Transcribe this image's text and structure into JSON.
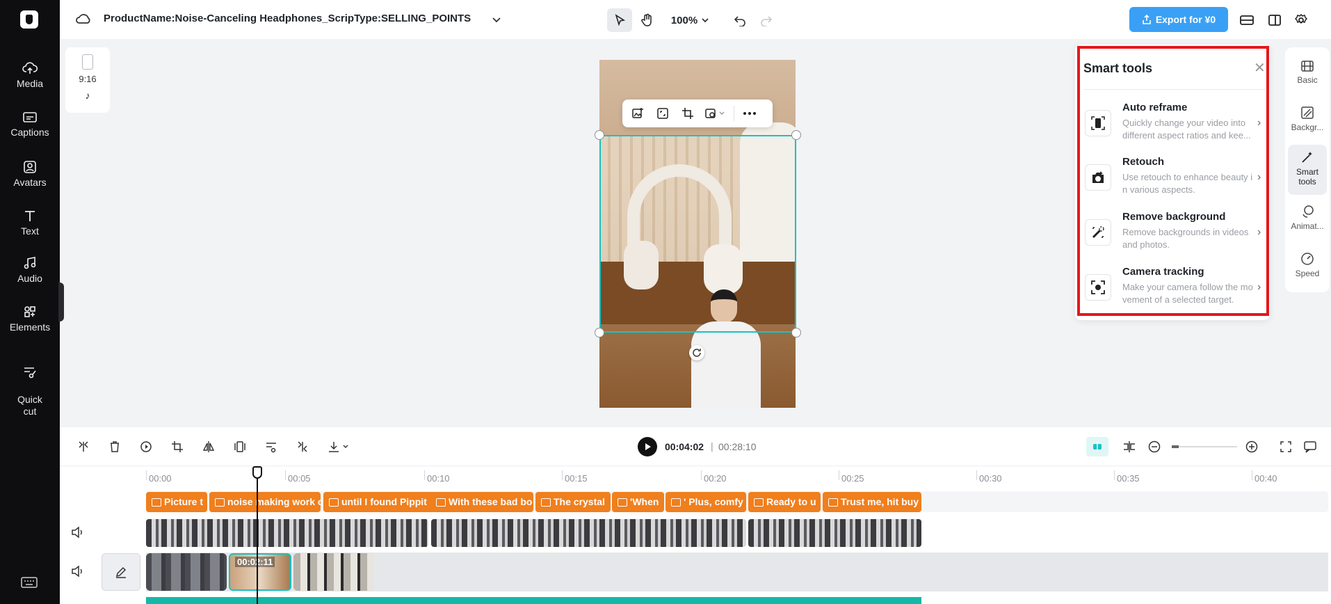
{
  "nav": {
    "items": [
      {
        "label": "Media",
        "icon": "cloud-upload-icon"
      },
      {
        "label": "Captions",
        "icon": "captions-icon"
      },
      {
        "label": "Avatars",
        "icon": "avatar-icon"
      },
      {
        "label": "Text",
        "icon": "text-icon"
      },
      {
        "label": "Audio",
        "icon": "music-note-icon"
      },
      {
        "label": "Elements",
        "icon": "elements-icon"
      },
      {
        "label": "Quick\ncut",
        "icon": "scissors-icon"
      }
    ]
  },
  "topbar": {
    "project_title": "ProductName:Noise-Canceling Headphones_ScripType:SELLING_POINTS",
    "zoom": "100%",
    "export_label": "Export for ¥0"
  },
  "canvas": {
    "aspect_ratio": "9:16"
  },
  "smart_tools": {
    "title": "Smart tools",
    "tools": [
      {
        "name": "Auto reframe",
        "desc": "Quickly change your video into different aspect ratios and kee...",
        "icon": "reframe-icon"
      },
      {
        "name": "Retouch",
        "desc": "Use retouch to enhance beauty i n various aspects.",
        "icon": "retouch-icon"
      },
      {
        "name": "Remove background",
        "desc": "Remove backgrounds in videos and photos.",
        "icon": "remove-background-icon"
      },
      {
        "name": "Camera tracking",
        "desc": "Make your camera follow the mo vement of a selected target.",
        "icon": "camera-tracking-icon"
      }
    ]
  },
  "right_rail": {
    "items": [
      {
        "label": "Basic"
      },
      {
        "label": "Backgr..."
      },
      {
        "label": "Smart tools"
      },
      {
        "label": "Animat..."
      },
      {
        "label": "Speed"
      }
    ]
  },
  "playback": {
    "current_time": "00:04:02",
    "total_time": "00:28:10"
  },
  "timeline": {
    "ruler": [
      "00:00",
      "00:05",
      "00:10",
      "00:15",
      "00:20",
      "00:25",
      "00:30",
      "00:35",
      "00:40"
    ],
    "captions": [
      "Picture t",
      "noise making work c",
      "until I found Pippit",
      "With these bad bo",
      "The crystal",
      "'When",
      "' Plus, comfy",
      "Ready to u",
      "Trust me, hit buy"
    ],
    "selected_clip_time": "00:02:11"
  },
  "colors": {
    "accent": "#3aa0f5",
    "caption_clip": "#f07f1d",
    "selection": "#19c2c5",
    "highlight_frame": "#e5161d"
  }
}
